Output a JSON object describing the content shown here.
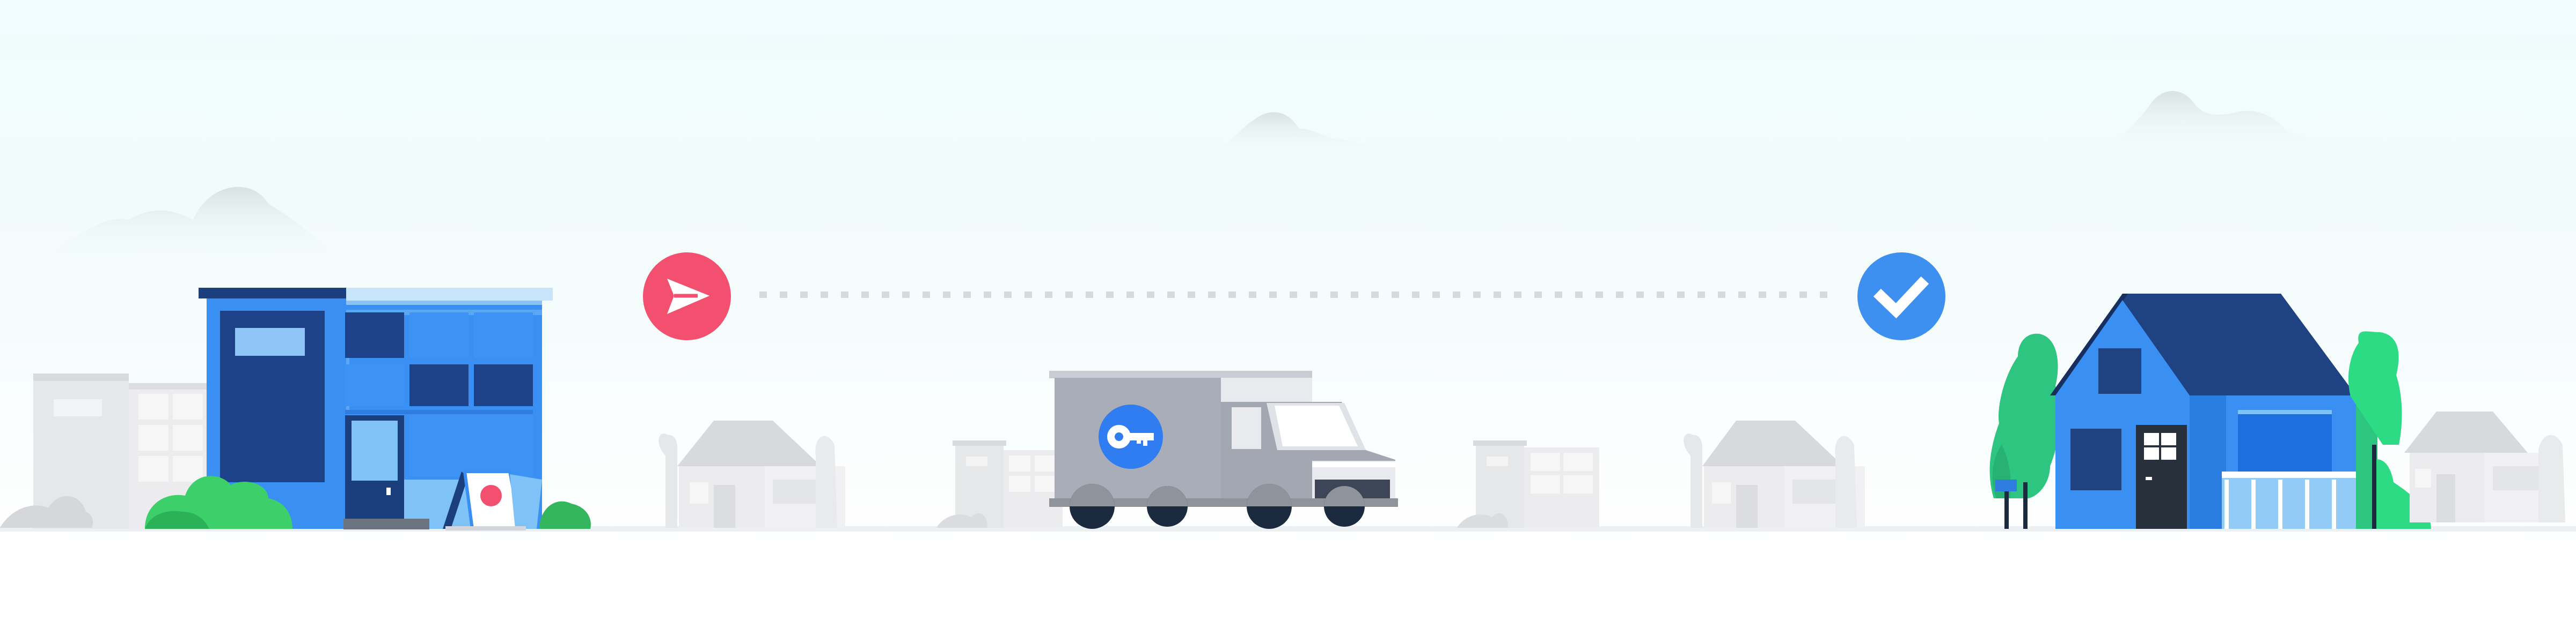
{
  "scene": {
    "description_icons": [
      "send-icon",
      "checkmark-icon",
      "key-icon"
    ],
    "colors": {
      "send_badge": "#f2506e",
      "check_badge": "#3d8ff0",
      "key_badge": "#2f7df0",
      "building_blue": "#3a8ff2",
      "building_navy": "#1b3f7d",
      "house_roof": "#1e4282",
      "tree_green": "#2dc57f",
      "bush_green": "#3ccf6a",
      "truck_gray": "#a9adb7",
      "muted_house": "#e3e4e6",
      "cloud": "#dfe6e6",
      "ground": "#edf0f3"
    }
  }
}
